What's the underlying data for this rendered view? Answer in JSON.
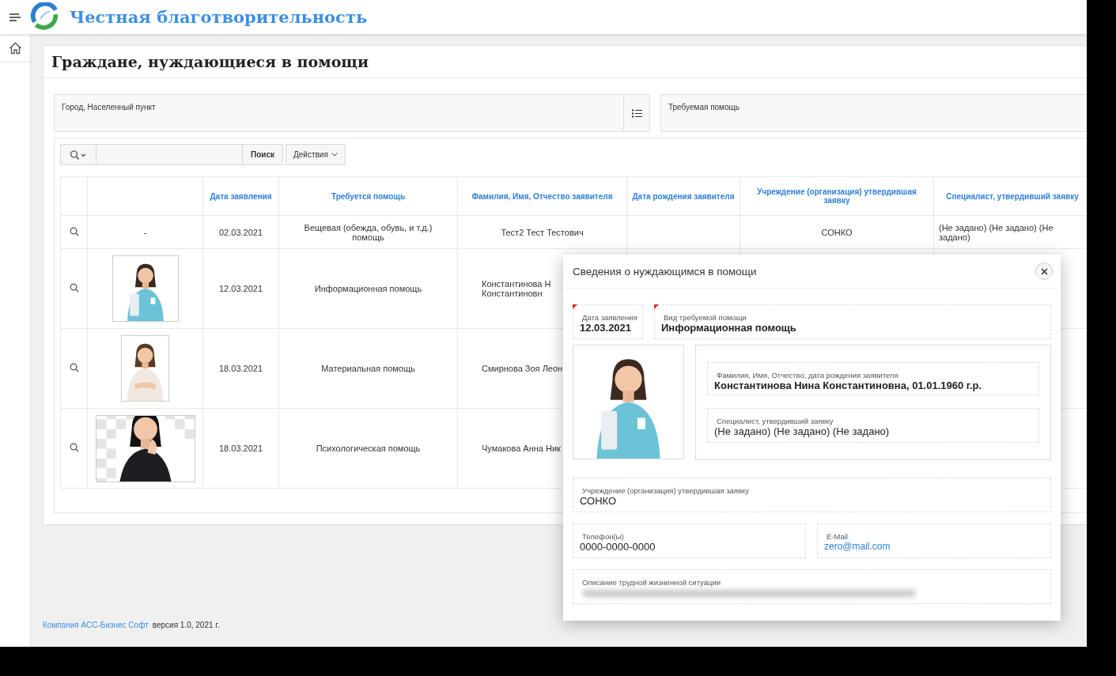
{
  "header": {
    "title": "Честная благотворительность"
  },
  "page_title": "Граждане, нуждающиеся в помощи",
  "filters": [
    {
      "label": "Город, Населенный пункт",
      "kind": "list"
    },
    {
      "label": "Требуемая помощь",
      "kind": "plain"
    }
  ],
  "toolbar": {
    "search_button": "Поиск",
    "actions_button": "Действия"
  },
  "table": {
    "columns": [
      "Дата заявления",
      "Требуется помощь",
      "Фамилия, Имя, Отчество заявителя",
      "Дата рождения заявителя",
      "Учреждение (организация) утвердившая заявку",
      "Специалист, утвердивший заявку"
    ],
    "rows": [
      {
        "photo_text": "-",
        "date": "02.03.2021",
        "help": "Вещевая (обежда, обувь, и т.д.) помощь",
        "name": "Тест2 Тест Тестович",
        "org": "СОНКО",
        "specialist": "(Не задано) (Не задано) (Не задано)"
      },
      {
        "date": "12.03.2021",
        "help": "Информационная помощь",
        "name": "Константинова Н\nКонстантиновн"
      },
      {
        "date": "18.03.2021",
        "help": "Материальная помощь",
        "name": "Смирнова Зоя Леон"
      },
      {
        "date": "18.03.2021",
        "help": "Психологическая помощь",
        "name": "Чумакова Анна Ник"
      }
    ]
  },
  "modal": {
    "title": "Сведения о нуждающимся в помощи",
    "date": {
      "label": "Дата заявления",
      "value": "12.03.2021",
      "required": true
    },
    "help_type": {
      "label": "Вид требуемой помощи",
      "value": "Информационная помощь",
      "required": true
    },
    "applicant": {
      "label": "Фамилия, Имя, Отчество, дата рождения заявителя",
      "value": "Константинова Нина Константиновна, 01.01.1960 г.р."
    },
    "specialist": {
      "label": "Специалист, утвердивший заявку",
      "value": "(Не задано) (Не задано) (Не задано)"
    },
    "organization": {
      "label": "Учреждение (организация) утвердившая заявку",
      "value": "СОНКО"
    },
    "phone": {
      "label": "Телефон(ы)",
      "value": "0000-0000-0000"
    },
    "email": {
      "label": "E-Mail",
      "value": "zero@mail.com"
    },
    "description": {
      "label": "Описание трудной жизненной ситуации",
      "redacted": true
    }
  },
  "footer": {
    "company": "Компания АСС-Бизнес Софт",
    "version": "версия 1.0, 2021 г."
  }
}
